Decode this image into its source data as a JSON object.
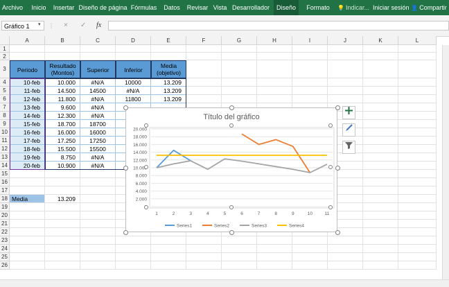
{
  "ribbon": {
    "tabs": [
      {
        "label": "Archivo",
        "active": false
      },
      {
        "label": "Inicio",
        "active": false
      },
      {
        "label": "Insertar",
        "active": false
      },
      {
        "label": "Diseño de página",
        "active": false
      },
      {
        "label": "Fórmulas",
        "active": false
      },
      {
        "label": "Datos",
        "active": false
      },
      {
        "label": "Revisar",
        "active": false
      },
      {
        "label": "Vista",
        "active": false
      },
      {
        "label": "Desarrollador",
        "active": false
      },
      {
        "label": "Diseño",
        "active": true
      },
      {
        "label": "Formato",
        "active": false
      },
      {
        "label": "Indicar...",
        "active": false
      },
      {
        "label": "Iniciar sesión",
        "active": false
      },
      {
        "label": "Compartir",
        "active": false
      }
    ],
    "accent": "#217346"
  },
  "formula_bar": {
    "name_box": "Gráfico 1",
    "fx_label": "fx",
    "cancel_icon": "×",
    "enter_icon": "✓",
    "value": ""
  },
  "columns": [
    "A",
    "B",
    "C",
    "D",
    "E",
    "F",
    "G",
    "H",
    "I",
    "J",
    "K",
    "L"
  ],
  "rows": [
    "1",
    "2",
    "3",
    "4",
    "5",
    "6",
    "7",
    "8",
    "9",
    "10",
    "11",
    "12",
    "13",
    "14",
    "15",
    "16",
    "17",
    "18",
    "19",
    "20",
    "21",
    "22",
    "23",
    "24",
    "25",
    "26"
  ],
  "table": {
    "headers": [
      "Periodo",
      "Resultado\n(Montos)",
      "Superior",
      "Inferior",
      "Media\n(objetivo)"
    ],
    "rows": [
      [
        "10-feb",
        "10.000",
        "#N/A",
        "10000",
        "13.209"
      ],
      [
        "11-feb",
        "14.500",
        "14500",
        "#N/A",
        "13.209"
      ],
      [
        "12-feb",
        "11.800",
        "#N/A",
        "11800",
        "13.209"
      ],
      [
        "13-feb",
        "9.600",
        "#N/A",
        "",
        ""
      ],
      [
        "14-feb",
        "12.300",
        "#N/A",
        "",
        ""
      ],
      [
        "15-feb",
        "18.700",
        "18700",
        "",
        ""
      ],
      [
        "16-feb",
        "16.000",
        "16000",
        "",
        ""
      ],
      [
        "17-feb",
        "17.250",
        "17250",
        "",
        ""
      ],
      [
        "18-feb",
        "15.500",
        "15500",
        "",
        ""
      ],
      [
        "19-feb",
        "8.750",
        "#N/A",
        "",
        ""
      ],
      [
        "20-feb",
        "10.900",
        "#N/A",
        "",
        ""
      ]
    ],
    "header_color": "#5b9bd5"
  },
  "media_row": {
    "label": "Media",
    "value": "13.209"
  },
  "chart_data": {
    "type": "line",
    "title": "Título del gráfico",
    "x": [
      1,
      2,
      3,
      4,
      5,
      6,
      7,
      8,
      9,
      10,
      11
    ],
    "y_ticks": [
      "0",
      "2.000",
      "4.000",
      "6.000",
      "8.000",
      "10.000",
      "12.000",
      "14.000",
      "16.000",
      "18.000",
      "20.000"
    ],
    "ylim": [
      0,
      20000
    ],
    "grid": true,
    "legend_position": "bottom",
    "series": [
      {
        "name": "Series1",
        "color": "#5b9bd5",
        "values": [
          10000,
          14500,
          11800,
          null,
          null,
          18700,
          null,
          null,
          null,
          null,
          null
        ]
      },
      {
        "name": "Series2",
        "color": "#ed7d31",
        "values": [
          null,
          14500,
          null,
          null,
          null,
          18700,
          16000,
          17250,
          15500,
          8750,
          null
        ]
      },
      {
        "name": "Series3",
        "color": "#a5a5a5",
        "values": [
          10000,
          11000,
          11800,
          9600,
          12300,
          11700,
          11000,
          10300,
          9600,
          8750,
          10900
        ]
      },
      {
        "name": "Series4",
        "color": "#ffc000",
        "values": [
          13209,
          13209,
          13209,
          13209,
          13209,
          13209,
          13209,
          13209,
          13209,
          13209,
          13209
        ]
      }
    ]
  },
  "icons": {
    "chart_elements": "plus-icon",
    "chart_styles": "brush-icon",
    "chart_filters": "filter-icon",
    "lightbulb": "lightbulb-icon",
    "person": "person-icon"
  }
}
